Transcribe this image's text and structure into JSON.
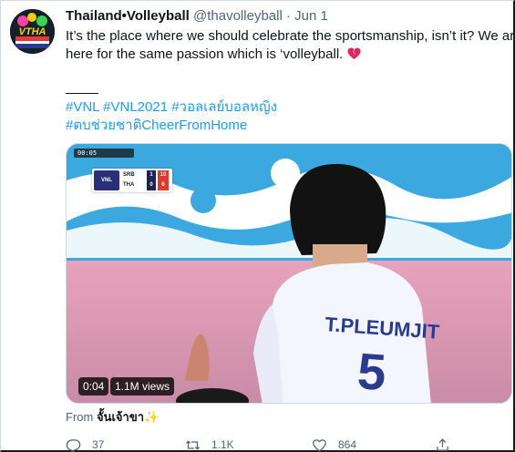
{
  "tweet": {
    "display_name": "Thailand•Volleyball",
    "handle": "@thavolleyball",
    "separator": "·",
    "date": "Jun 1",
    "text_line1": "It’s the place where we should celebrate the sportsmanship, isn’t it? We are",
    "text_line2": "here for the same passion which is ‘volleyball.",
    "hashtags_row1": [
      "#VNL",
      "#VNL2021",
      "#วอลเลย์บอลหญิง"
    ],
    "hashtags_row2": [
      "#ตบช่วยชาติCheerFromHome"
    ]
  },
  "avatar": {
    "label": "VTHA",
    "sub": "VOLLEYBALL"
  },
  "video": {
    "timebar": "00:05",
    "scoreboard": {
      "logo": "VNL",
      "team1": "SRB",
      "team1_sets": "1",
      "team1_points": "10",
      "team2": "THA",
      "team2_sets": "0",
      "team2_points": "6"
    },
    "jersey_text": "T.PLEUMJIT",
    "jersey_number": "5",
    "duration": "0:04",
    "views": "1.1M views"
  },
  "from": {
    "label": "From",
    "name": "จั้นเจ้าขา",
    "emoji": "✨"
  },
  "actions": {
    "replies": "37",
    "retweets": "1.1K",
    "likes": "864"
  },
  "colors": {
    "link": "#1d9bf0",
    "muted": "#536471",
    "heart": "#e0245e"
  },
  "icons": {
    "reply": "reply-icon",
    "retweet": "retweet-icon",
    "like": "heart-icon",
    "share": "share-icon",
    "broken_heart": "broken-heart-icon"
  }
}
